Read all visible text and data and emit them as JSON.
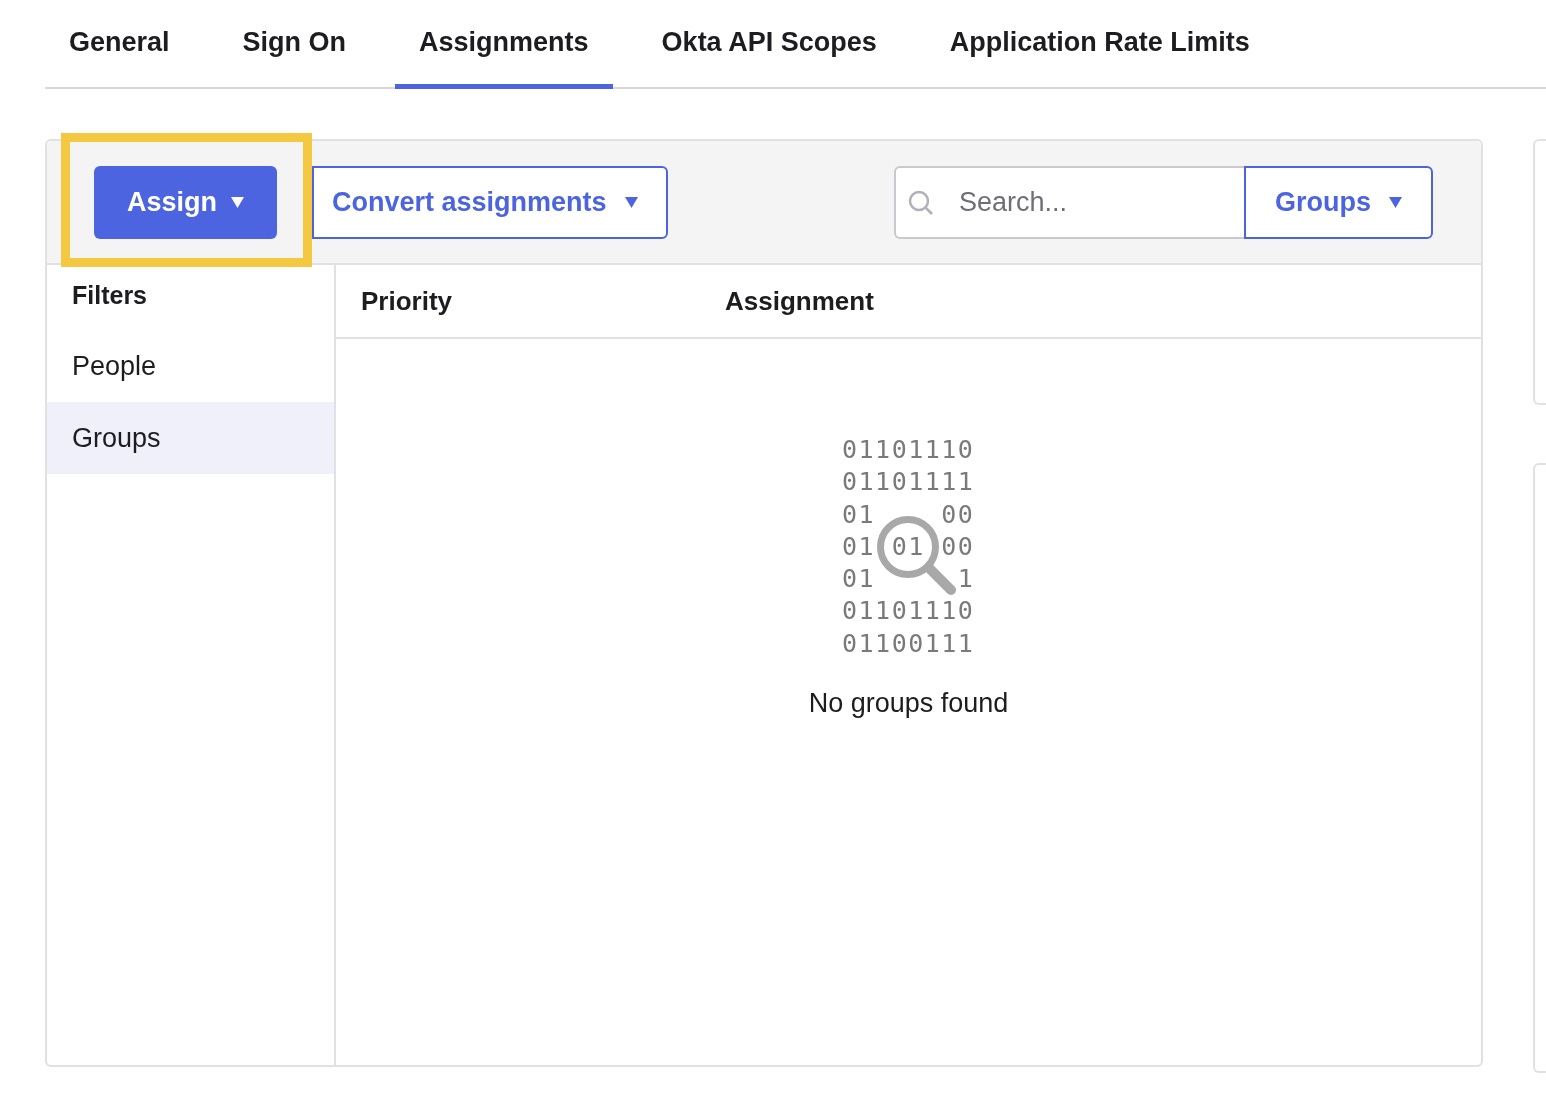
{
  "tabs": [
    {
      "label": "General",
      "selected": false
    },
    {
      "label": "Sign On",
      "selected": false
    },
    {
      "label": "Assignments",
      "selected": true
    },
    {
      "label": "Okta API Scopes",
      "selected": false
    },
    {
      "label": "Application Rate Limits",
      "selected": false
    }
  ],
  "toolbar": {
    "assign_button": {
      "label": "Assign",
      "highlighted": true
    },
    "convert_button": {
      "label": "Convert assignments"
    },
    "search": {
      "placeholder": "Search..."
    },
    "type_dropdown": {
      "label": "Groups"
    }
  },
  "filters": {
    "title": "Filters",
    "items": [
      {
        "label": "People",
        "selected": false
      },
      {
        "label": "Groups",
        "selected": true
      }
    ]
  },
  "table": {
    "columns": [
      "Priority",
      "Assignment"
    ]
  },
  "empty_state": {
    "binary_lines": [
      "01101110",
      "01101111",
      "01    00",
      "01 01 00",
      "01     1",
      "01101110",
      "01100111"
    ],
    "message": "No groups found"
  }
}
